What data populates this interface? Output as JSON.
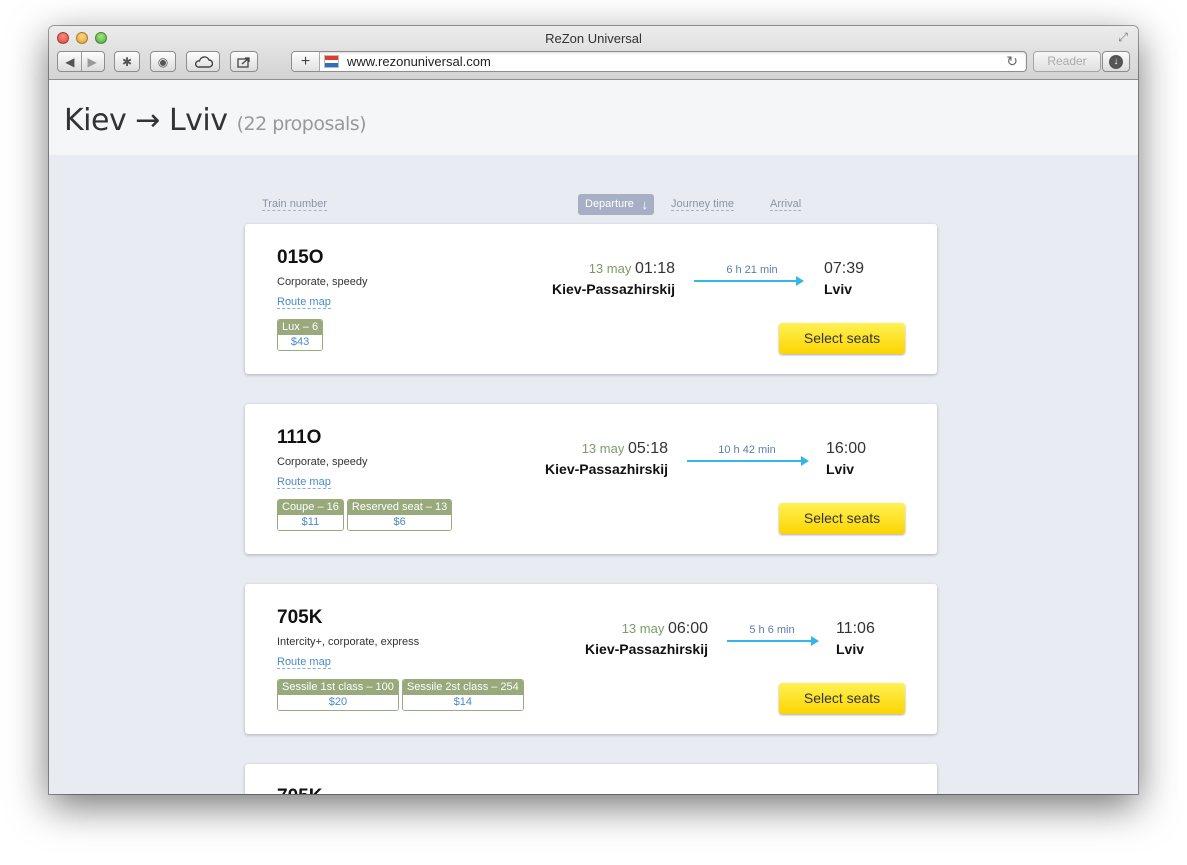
{
  "browser": {
    "title": "ReZon Universal",
    "url": "www.rezonuniversal.com",
    "reader_label": "Reader"
  },
  "page": {
    "from": "Kiev",
    "arrow": "→",
    "to": "Lviv",
    "proposals": "(22 proposals)"
  },
  "sort": {
    "train_number": "Train number",
    "departure": "Departure",
    "journey_time": "Journey time",
    "arrival": "Arrival"
  },
  "cards": [
    {
      "number": "015O",
      "type": "Corporate, speedy",
      "route_map": "Route map",
      "classes": [
        {
          "name": "Lux – 6",
          "price": "$43"
        }
      ],
      "date": "13 may",
      "dep_time": "01:18",
      "dep_station": "Kiev-Passazhirskij",
      "duration": "6 h 21 min",
      "arr_time": "07:39",
      "arr_station": "Lviv",
      "select": "Select seats"
    },
    {
      "number": "111O",
      "type": "Corporate, speedy",
      "route_map": "Route map",
      "classes": [
        {
          "name": "Coupe – 16",
          "price": "$11"
        },
        {
          "name": "Reserved seat – 13",
          "price": "$6"
        }
      ],
      "date": "13 may",
      "dep_time": "05:18",
      "dep_station": "Kiev-Passazhirskij",
      "duration": "10 h 42 min",
      "arr_time": "16:00",
      "arr_station": "Lviv",
      "select": "Select seats"
    },
    {
      "number": "705K",
      "type": "Intercity+, corporate, express",
      "route_map": "Route map",
      "classes": [
        {
          "name": "Sessile 1st class – 100",
          "price": "$20"
        },
        {
          "name": "Sessile 2st class – 254",
          "price": "$14"
        }
      ],
      "date": "13 may",
      "dep_time": "06:00",
      "dep_station": "Kiev-Passazhirskij",
      "duration": "5 h 6 min",
      "arr_time": "11:06",
      "arr_station": "Lviv",
      "select": "Select seats"
    },
    {
      "number": "705K"
    }
  ],
  "colors": {
    "accent_yellow": "#fbd500",
    "journey_arrow": "#35b6e8",
    "class_badge": "#98a97c"
  }
}
